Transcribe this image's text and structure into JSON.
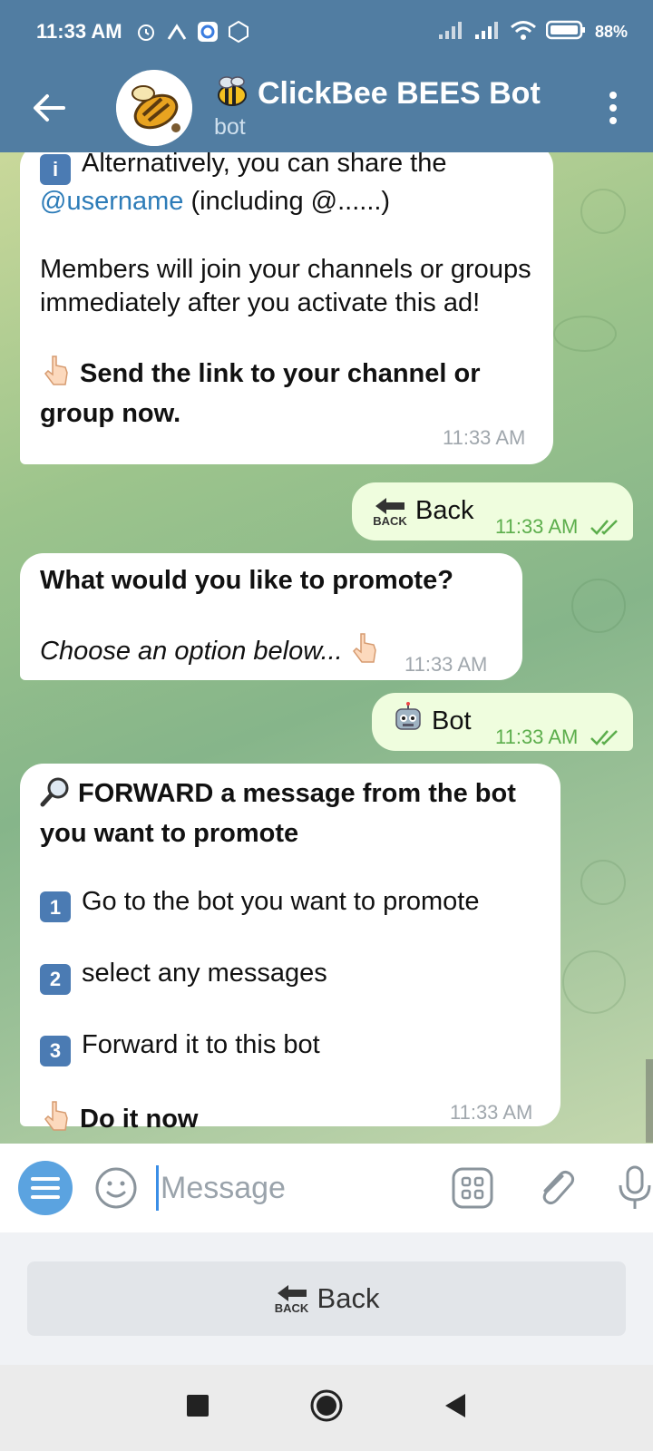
{
  "status_bar": {
    "time": "11:33 AM",
    "battery": "88%"
  },
  "header": {
    "title": "ClickBee BEES Bot",
    "subtitle": "bot",
    "title_emoji": "bee-icon"
  },
  "messages": {
    "m1": {
      "line1": "Alternatively, you can share the",
      "mention": "@username",
      "line2_rest": " (including @......)",
      "para2": "Members will join your channels or groups immediately after you activate this ad!",
      "bold_cta": "Send the link to your channel or group now.",
      "time": "11:33 AM"
    },
    "m2": {
      "label": "Back",
      "icon_text": "BACK",
      "time": "11:33 AM"
    },
    "m3": {
      "title": "What would you like to promote?",
      "sub": "Choose an option below...",
      "time": "11:33 AM"
    },
    "m4": {
      "label": "Bot",
      "time": "11:33 AM"
    },
    "m5": {
      "title": "FORWARD a message from the bot you want to promote",
      "step1_num": "1",
      "step1": "Go to the bot you want to promote",
      "step2_num": "2",
      "step2": "select any messages",
      "step3_num": "3",
      "step3": "Forward it to this bot",
      "cta": "Do it now",
      "time": "11:33 AM"
    }
  },
  "input": {
    "placeholder": "Message"
  },
  "keyboard": {
    "back_label": "Back",
    "back_icon_text": "BACK"
  },
  "colors": {
    "header": "#517da2",
    "out_bubble": "#effdde",
    "accent": "#5ba3e0",
    "link": "#2d7cb8"
  }
}
